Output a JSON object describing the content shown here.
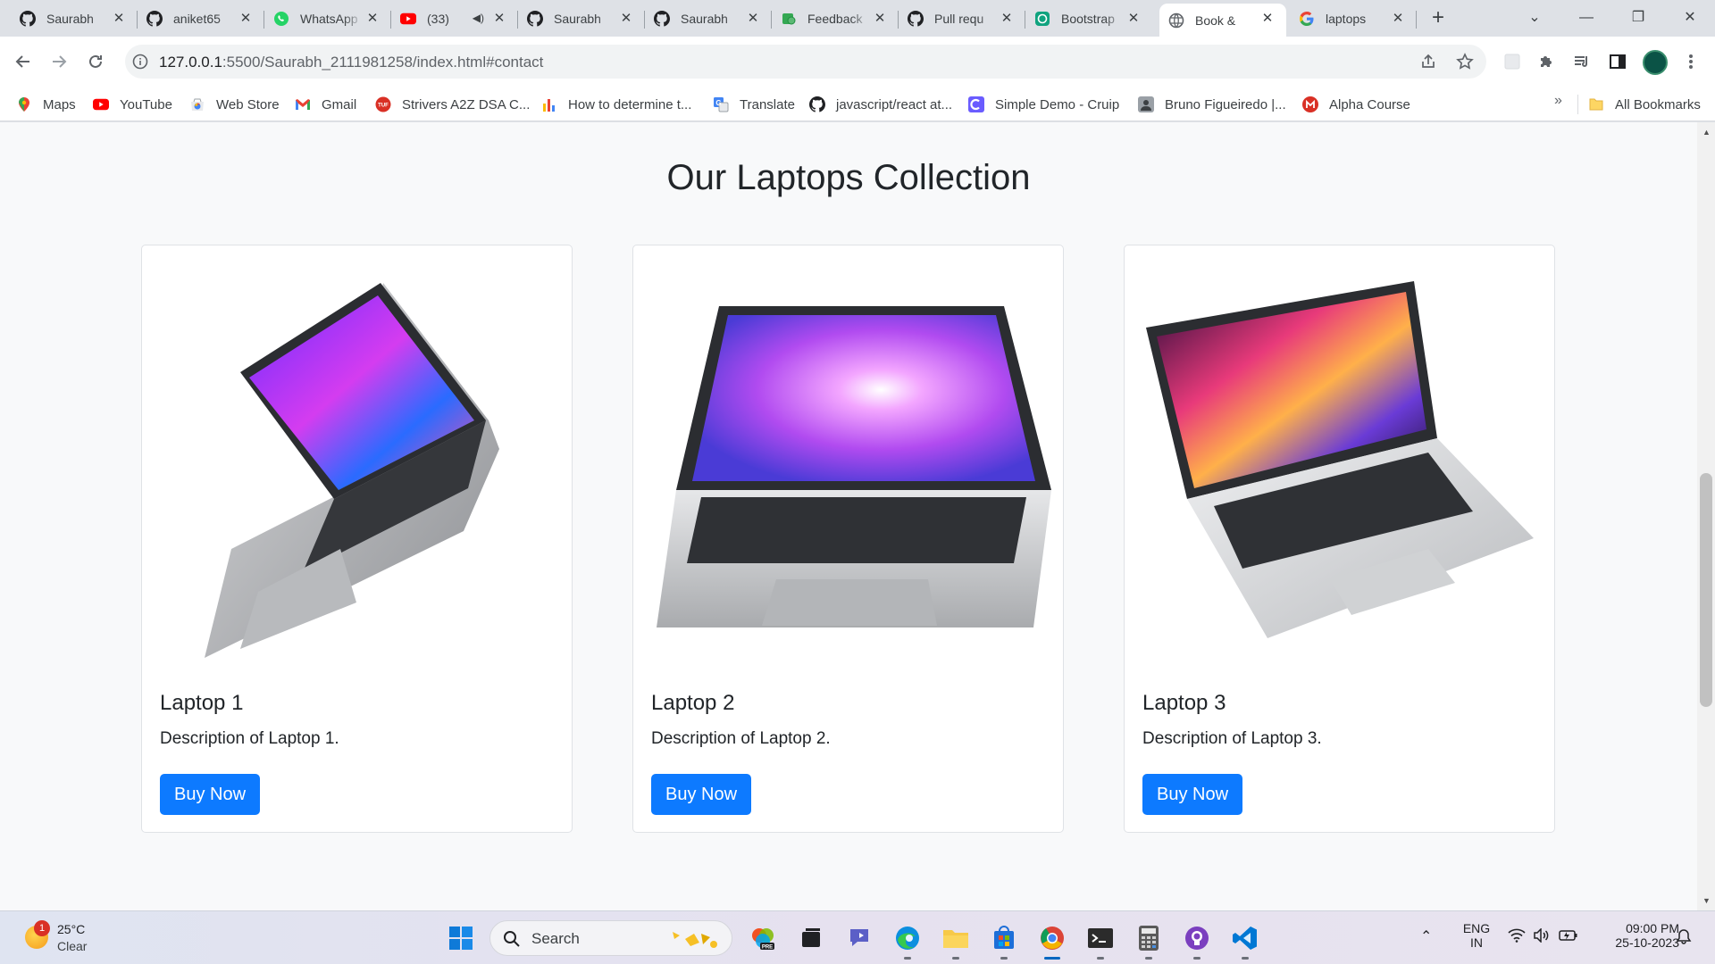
{
  "browser": {
    "tabs": [
      {
        "label": "Saurabh",
        "icon": "github-icon"
      },
      {
        "label": "aniket65",
        "icon": "github-icon"
      },
      {
        "label": "WhatsApp",
        "icon": "whatsapp-icon"
      },
      {
        "label": "(33)",
        "icon": "youtube-icon"
      },
      {
        "label": "Saurabh",
        "icon": "github-icon"
      },
      {
        "label": "Saurabh",
        "icon": "github-icon"
      },
      {
        "label": "Feedback",
        "icon": "feedback-icon"
      },
      {
        "label": "Pull requ",
        "icon": "github-icon"
      },
      {
        "label": "Bootstrap",
        "icon": "chatgpt-icon"
      },
      {
        "label": "Book &",
        "icon": "globe-icon"
      },
      {
        "label": "laptops",
        "icon": "google-icon"
      }
    ],
    "active_tab_index": 9,
    "url_host": "127.0.0.1",
    "url_rest": ":5500/Saurabh_2111981258/index.html#contact"
  },
  "bookmarks": [
    {
      "label": "Maps",
      "icon": "maps-icon"
    },
    {
      "label": "YouTube",
      "icon": "youtube-icon"
    },
    {
      "label": "Web Store",
      "icon": "webstore-icon"
    },
    {
      "label": "Gmail",
      "icon": "gmail-icon"
    },
    {
      "label": "Strivers A2Z DSA C...",
      "icon": "tuf-icon"
    },
    {
      "label": "How to determine t...",
      "icon": "bar-chart-icon"
    },
    {
      "label": "Translate",
      "icon": "translate-icon"
    },
    {
      "label": "javascript/react at...",
      "icon": "github-icon"
    },
    {
      "label": "Simple Demo - Cruip",
      "icon": "cruip-icon"
    },
    {
      "label": "Bruno Figueiredo |...",
      "icon": "avatar-icon"
    },
    {
      "label": "Alpha Course",
      "icon": "alpha-icon"
    }
  ],
  "all_bookmarks_label": "All Bookmarks",
  "page": {
    "title": "Our Laptops Collection",
    "products": [
      {
        "name": "Laptop 1",
        "description": "Description of Laptop 1.",
        "button": "Buy Now"
      },
      {
        "name": "Laptop 2",
        "description": "Description of Laptop 2.",
        "button": "Buy Now"
      },
      {
        "name": "Laptop 3",
        "description": "Description of Laptop 3.",
        "button": "Buy Now"
      }
    ]
  },
  "taskbar": {
    "weather_temp": "25°C",
    "weather_cond": "Clear",
    "weather_badge": "1",
    "search_label": "Search",
    "lang_top": "ENG",
    "lang_bottom": "IN",
    "time": "09:00 PM",
    "date": "25-10-2023"
  },
  "colors": {
    "accent_button": "#0d7aff",
    "page_background": "#f8f9fa",
    "tabstrip": "#dee1e6"
  }
}
